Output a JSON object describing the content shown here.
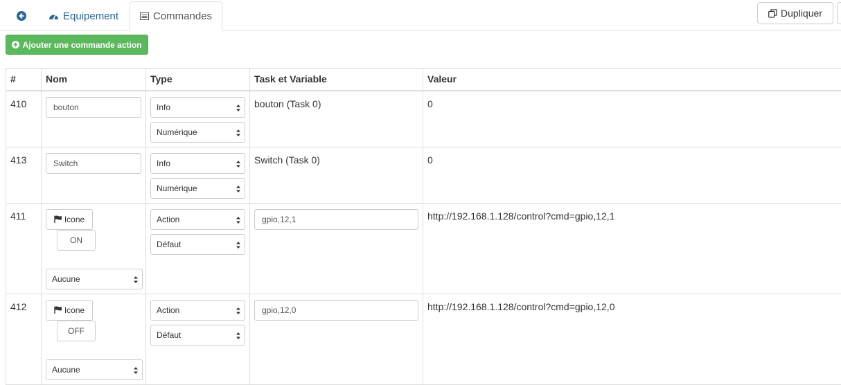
{
  "tabs": {
    "equipement_label": "Equipement",
    "commandes_label": "Commandes"
  },
  "toolbar": {
    "dupliquer_label": "Dupliquer",
    "add_action_label": "Ajouter une commande action"
  },
  "table": {
    "headers": [
      "#",
      "Nom",
      "Type",
      "Task et Variable",
      "Valeur"
    ],
    "rows": [
      {
        "id": "410",
        "name": "bouton",
        "type": "Info",
        "subtype": "Numérique",
        "task": "bouton (Task 0)",
        "value": "0"
      },
      {
        "id": "413",
        "name": "Switch",
        "type": "Info",
        "subtype": "Numérique",
        "task": "Switch (Task 0)",
        "value": "0"
      },
      {
        "id": "411",
        "icon_label": "Icone",
        "name": "ON",
        "display": "Aucune",
        "type": "Action",
        "subtype": "Défaut",
        "task": "gpio,12,1",
        "value": "http://192.168.1.128/control?cmd=gpio,12,1"
      },
      {
        "id": "412",
        "icon_label": "Icone",
        "name": "OFF",
        "display": "Aucune",
        "type": "Action",
        "subtype": "Défaut",
        "task": "gpio,12,0",
        "value": "http://192.168.1.128/control?cmd=gpio,12,0"
      }
    ]
  },
  "colors": {
    "link": "#2a6496",
    "success": "#5cb85c",
    "border": "#dddddd"
  },
  "icons": [
    "back-circle-icon",
    "dashboard-icon",
    "list-icon",
    "copy-icon",
    "plus-circle-icon",
    "flag-icon",
    "select-arrows-icon"
  ]
}
